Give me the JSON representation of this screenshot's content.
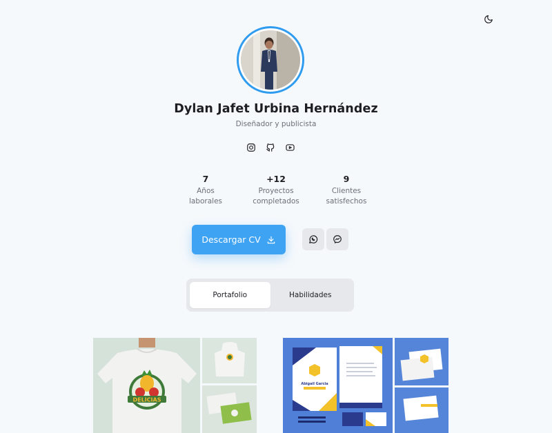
{
  "profile": {
    "name": "Dylan Jafet Urbina Hernández",
    "role": "Diseñador y publicista"
  },
  "socials": [
    {
      "icon": "instagram-icon"
    },
    {
      "icon": "github-icon"
    },
    {
      "icon": "youtube-icon"
    }
  ],
  "stats": [
    {
      "value": "7",
      "label": "Años\nlaborales"
    },
    {
      "value": "+12",
      "label": "Proyectos\ncompletados"
    },
    {
      "value": "9",
      "label": "Clientes\nsatisfechos"
    }
  ],
  "actions": {
    "download_cv_label": "Descargar CV",
    "download_icon": "download-icon",
    "whatsapp_icon": "whatsapp-icon",
    "messenger_icon": "messenger-icon"
  },
  "tabs": [
    {
      "label": "Portafolio",
      "active": true
    },
    {
      "label": "Habilidades",
      "active": false
    }
  ],
  "portfolio": {
    "item1": {
      "shirt_brand": "DELICIAS"
    },
    "item2": {
      "card_name": "Abigail Garcia"
    }
  },
  "colors": {
    "accent": "#3fa3f4",
    "background": "#f6f9fc",
    "text": "#1d1d24",
    "muted": "#6b6f78",
    "pill": "#e6e8eb"
  }
}
